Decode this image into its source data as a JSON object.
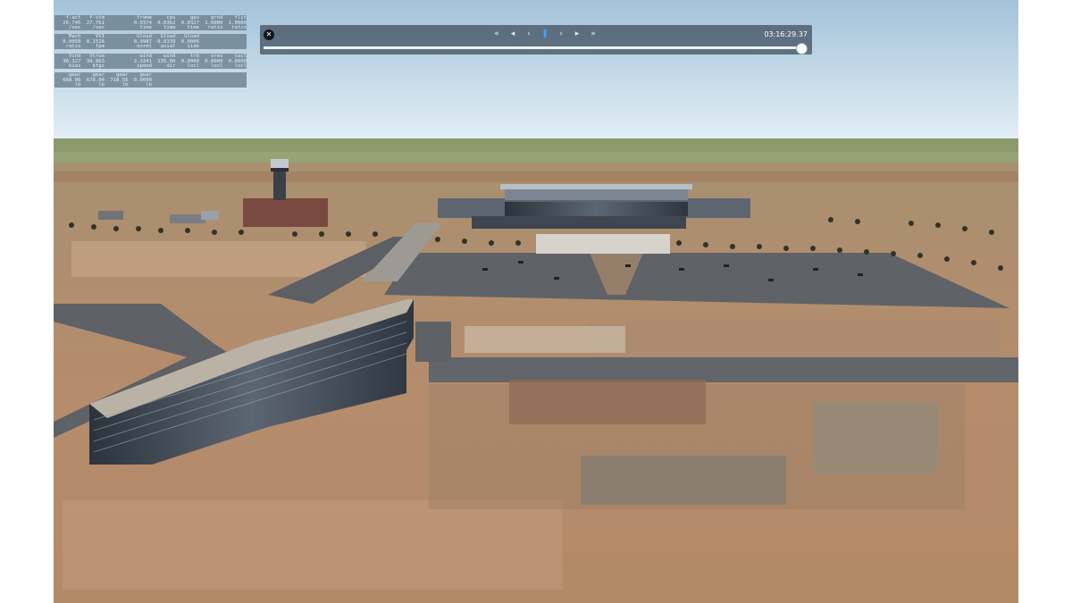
{
  "stats_panels": [
    {
      "labels": [
        "f-act",
        "f-sim",
        "",
        "frame",
        "cpu",
        "gpu",
        "grnd",
        "flit"
      ],
      "values": [
        "26.745",
        "27.761",
        "",
        "0.0374",
        "0.0362",
        "0.0327",
        "1.0000",
        "1.0000"
      ],
      "units": [
        "/sec",
        "/sec",
        "",
        "time",
        "time",
        "time",
        "ratio",
        "ratio"
      ]
    },
    {
      "labels": [
        "Mach",
        "VVI",
        "",
        "Gload",
        "Gload",
        "Gload",
        "",
        ""
      ],
      "values": [
        "0.0050",
        "0.1526",
        "",
        "0.9987",
        "-0.0339",
        "0.0006",
        "",
        ""
      ],
      "units": [
        "ratio",
        "fpm",
        "",
        "norml",
        "axial",
        "side",
        "",
        ""
      ]
    },
    {
      "labels": [
        "Vind",
        "Vtrue",
        "",
        "wind",
        "wind",
        "trb",
        "sres",
        "tail"
      ],
      "values": [
        "36.327",
        "34.863",
        "",
        "3.3341",
        "135.00",
        "0.0000",
        "0.0000",
        "0.0000"
      ],
      "units": [
        "kias",
        "ktgs",
        "",
        "speed",
        "dir",
        "locl",
        "locl",
        "locl"
      ]
    },
    {
      "labels": [
        "gear",
        "gear",
        "gear",
        "gear",
        "",
        "",
        "",
        ""
      ],
      "values": [
        "668.06",
        "678.04",
        "718.56",
        "0.0000",
        "",
        "",
        "",
        ""
      ],
      "units": [
        "lb",
        "lb",
        "lb",
        "lb",
        "",
        "",
        "",
        ""
      ]
    }
  ],
  "replay": {
    "close_icon": "close-icon",
    "controls": [
      {
        "name": "rewind-fast-button",
        "glyph": "«"
      },
      {
        "name": "rewind-button",
        "glyph": "◂"
      },
      {
        "name": "step-back-button",
        "glyph": "‹"
      },
      {
        "name": "pause-button",
        "glyph": "❚"
      },
      {
        "name": "step-forward-button",
        "glyph": "›"
      },
      {
        "name": "play-button",
        "glyph": "▸"
      },
      {
        "name": "fast-forward-button",
        "glyph": "»"
      }
    ],
    "active_control": 3,
    "time": "03:16:29.37",
    "progress": 0.99
  },
  "colors": {
    "sky_top": "#a9c6dc",
    "sky_horizon": "#e2eef5",
    "terrain": "#b08a66",
    "tarmac": "#5a5d62",
    "building": "#4a5058",
    "roof": "#b8b2a6",
    "accent": "#3aa3ff"
  }
}
